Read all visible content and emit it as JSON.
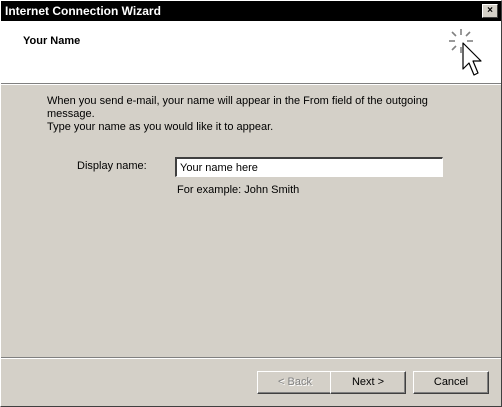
{
  "window": {
    "title": "Internet Connection Wizard",
    "close_glyph": "×"
  },
  "header": {
    "heading": "Your Name",
    "icon": "wizard-cursor-sparkle-icon"
  },
  "body": {
    "intro": "When you send e-mail, your name will appear in the From field of the outgoing message.\nType your name as you would like it to appear.",
    "display_name_label": "Display name:",
    "display_name_value": "Your name here",
    "example": "For example: John Smith"
  },
  "buttons": {
    "back": "< Back",
    "next": "Next >",
    "cancel": "Cancel"
  }
}
